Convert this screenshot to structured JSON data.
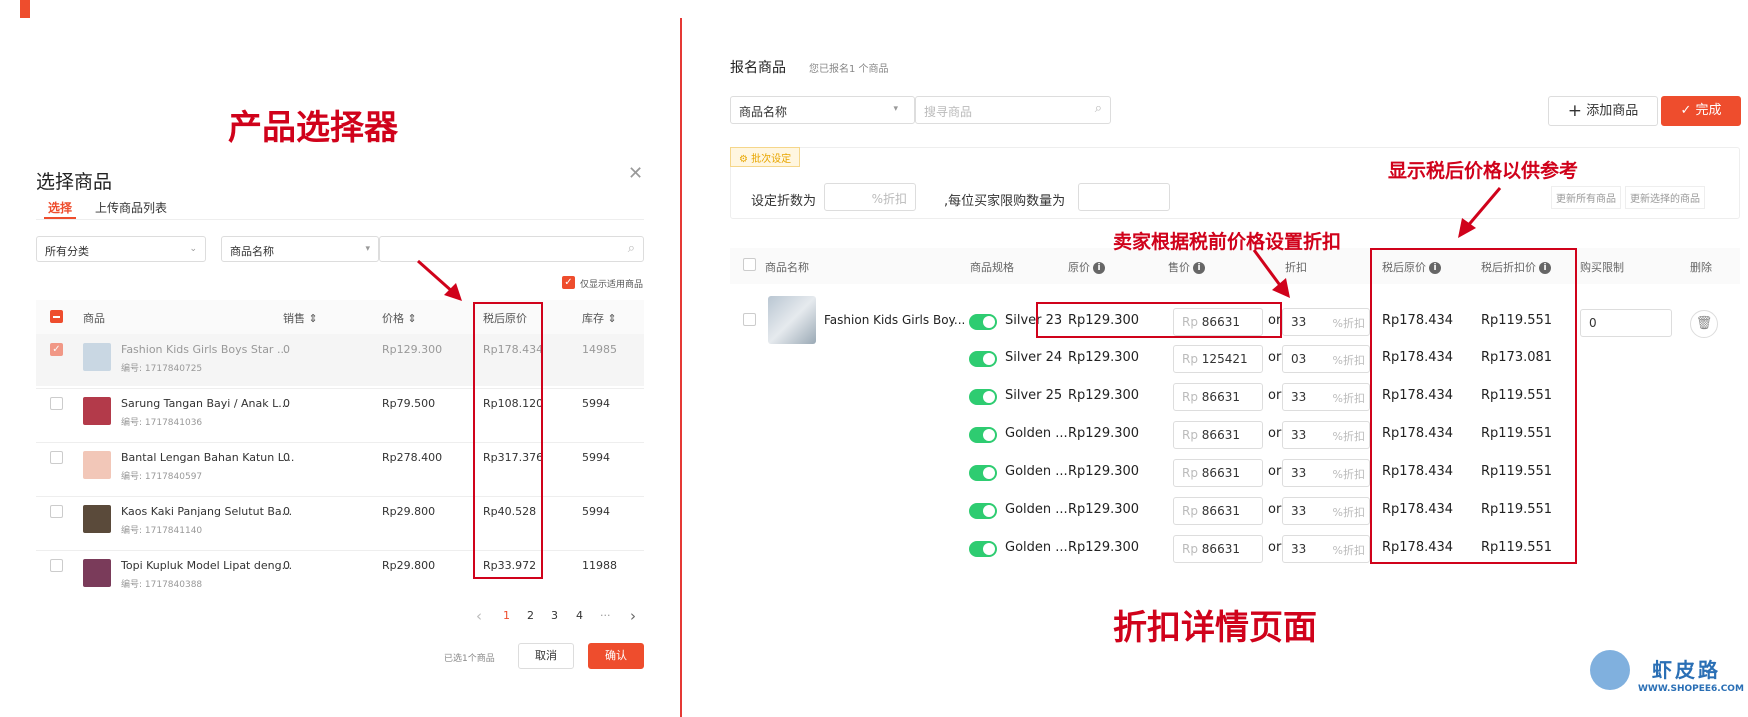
{
  "colors": {
    "accent": "#ee4d2d",
    "annotation": "#d0021b",
    "toggle": "#2ecc71"
  },
  "annotations": {
    "left_title": "产品选择器",
    "right_bottom_title": "折扣详情页面",
    "note_tax_price": "显示税后价格以供参考",
    "note_seller_discount": "卖家根据税前价格设置折扣"
  },
  "watermark": {
    "name": "虾皮路",
    "url": "WWW.SHOPEE6.COM"
  },
  "left_dialog": {
    "title": "选择商品",
    "close_icon": "close-icon",
    "tabs": [
      {
        "label": "选择",
        "active": true
      },
      {
        "label": "上传商品列表",
        "active": false
      }
    ],
    "category_select": "所有分类",
    "search_type_select": "商品名称",
    "search_placeholder": "",
    "only_show_label": "仅显示适用商品",
    "columns": {
      "product": "商品",
      "sales": "销售 ⇕",
      "price": "价格 ⇕",
      "after_tax": "税后原价",
      "stock": "库存 ⇕"
    },
    "rows": [
      {
        "name": "Fashion Kids Girls Boys Star ...",
        "id": "编号: 1717840725",
        "sales": "0",
        "price": "Rp129.300",
        "after_tax": "Rp178.434",
        "stock": "14985",
        "checked": true,
        "thumb": "#c9d7e3"
      },
      {
        "name": "Sarung Tangan Bayi / Anak L...",
        "id": "编号: 1717841036",
        "sales": "0",
        "price": "Rp79.500",
        "after_tax": "Rp108.120",
        "stock": "5994",
        "checked": false,
        "thumb": "#b33a4a"
      },
      {
        "name": "Bantal Lengan Bahan Katun L...",
        "id": "编号: 1717840597",
        "sales": "0",
        "price": "Rp278.400",
        "after_tax": "Rp317.376",
        "stock": "5994",
        "checked": false,
        "thumb": "#f2c7b8"
      },
      {
        "name": "Kaos Kaki Panjang Selutut Ba...",
        "id": "编号: 1717841140",
        "sales": "0",
        "price": "Rp29.800",
        "after_tax": "Rp40.528",
        "stock": "5994",
        "checked": false,
        "thumb": "#5a4a3a"
      },
      {
        "name": "Topi Kupluk Model Lipat deng...",
        "id": "编号: 1717840388",
        "sales": "0",
        "price": "Rp29.800",
        "after_tax": "Rp33.972",
        "stock": "11988",
        "checked": false,
        "thumb": "#7a3b5a"
      }
    ],
    "pagination": {
      "prev": "‹",
      "pages": [
        "1",
        "2",
        "3",
        "4"
      ],
      "ellipsis": "···",
      "next": "›",
      "current": "1"
    },
    "selected_count": "已选1个商品",
    "cancel_label": "取消",
    "confirm_label": "确认"
  },
  "right_panel": {
    "title": "报名商品",
    "subtitle": "您已报名1 个商品",
    "search_type_select": "商品名称",
    "search_placeholder": "搜寻商品",
    "add_product_label": "添加商品",
    "done_label": "完成",
    "batch_tag": "批次设定",
    "set_discount_label": "设定折数为",
    "discount_placeholder": "%折扣",
    "limit_label": ",每位买家限购数量为",
    "update_all_label": "更新所有商品",
    "update_selected_label": "更新选择的商品",
    "columns": {
      "name": "商品名称",
      "spec": "商品规格",
      "orig_price": "原价",
      "sale_price": "售价",
      "discount": "折扣",
      "after_tax_orig": "税后原价",
      "after_tax_disc": "税后折扣价",
      "limit": "购买限制",
      "delete": "删除"
    },
    "product_name": "Fashion Kids Girls Boy...",
    "currency": "Rp",
    "or_label": "or",
    "discount_unit": "%折扣",
    "limit_value": "0",
    "rows": [
      {
        "spec": "Silver 23",
        "orig": "Rp129.300",
        "sale": "86631",
        "disc": "33",
        "tax_orig": "Rp178.434",
        "tax_disc": "Rp119.551"
      },
      {
        "spec": "Silver 24",
        "orig": "Rp129.300",
        "sale": "125421",
        "disc": "03",
        "tax_orig": "Rp178.434",
        "tax_disc": "Rp173.081"
      },
      {
        "spec": "Silver 25",
        "orig": "Rp129.300",
        "sale": "86631",
        "disc": "33",
        "tax_orig": "Rp178.434",
        "tax_disc": "Rp119.551"
      },
      {
        "spec": "Golden ...",
        "orig": "Rp129.300",
        "sale": "86631",
        "disc": "33",
        "tax_orig": "Rp178.434",
        "tax_disc": "Rp119.551"
      },
      {
        "spec": "Golden ...",
        "orig": "Rp129.300",
        "sale": "86631",
        "disc": "33",
        "tax_orig": "Rp178.434",
        "tax_disc": "Rp119.551"
      },
      {
        "spec": "Golden ...",
        "orig": "Rp129.300",
        "sale": "86631",
        "disc": "33",
        "tax_orig": "Rp178.434",
        "tax_disc": "Rp119.551"
      },
      {
        "spec": "Golden ...",
        "orig": "Rp129.300",
        "sale": "86631",
        "disc": "33",
        "tax_orig": "Rp178.434",
        "tax_disc": "Rp119.551"
      }
    ]
  }
}
